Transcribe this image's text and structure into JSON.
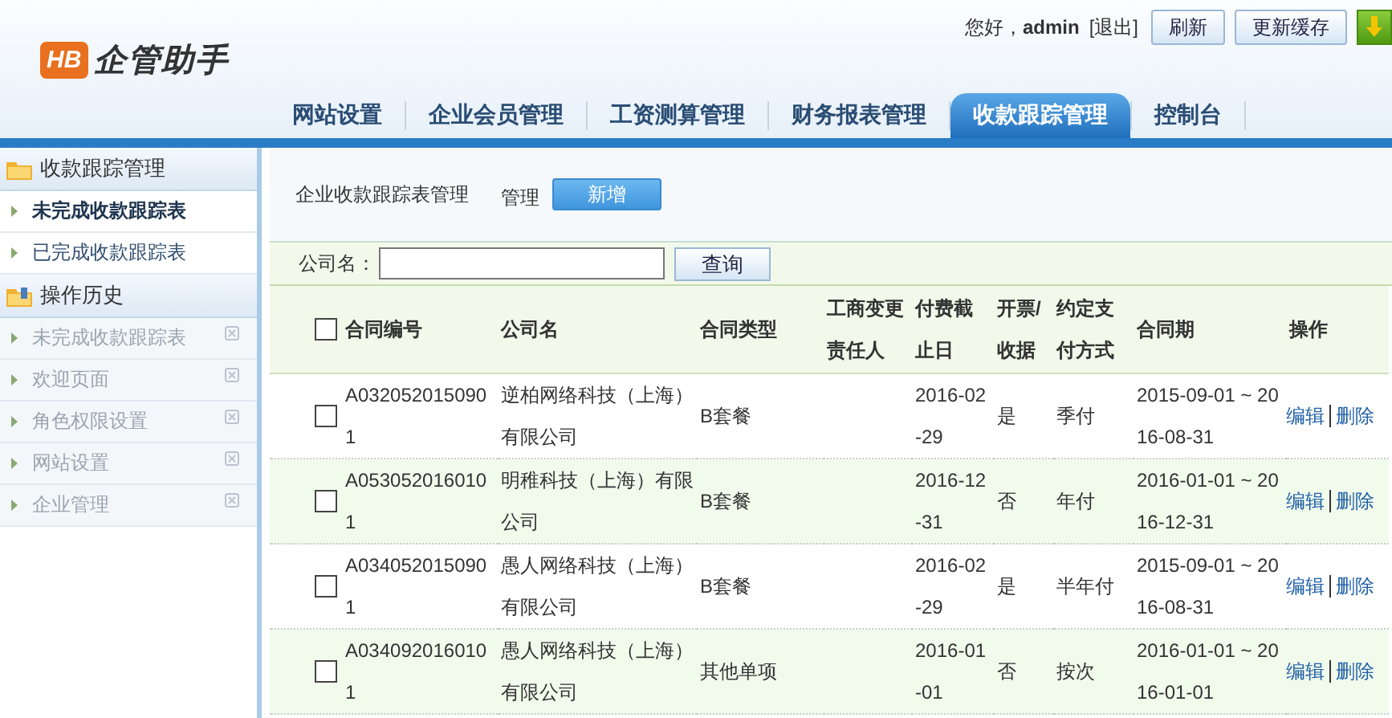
{
  "logo": {
    "badge": "HB",
    "name": "企管助手"
  },
  "top_bar": {
    "greeting": "您好，**admin**",
    "logout": "[退出]",
    "buttons": [
      "刷新",
      "更新缓存"
    ]
  },
  "nav_tabs": [
    {
      "label": "网站设置",
      "selected": false
    },
    {
      "label": "企业会员管理",
      "selected": false
    },
    {
      "label": "工资测算管理",
      "selected": false
    },
    {
      "label": "财务报表管理",
      "selected": false
    },
    {
      "label": "收款跟踪管理",
      "selected": true
    },
    {
      "label": "控制台",
      "selected": false
    }
  ],
  "sidebar": {
    "groups": [
      {
        "title": "收款跟踪管理",
        "kind": "menu",
        "items": [
          {
            "label": "未完成收款跟踪表",
            "selected": true
          },
          {
            "label": "已完成收款跟踪表",
            "selected": false
          }
        ]
      },
      {
        "title": "操作历史",
        "kind": "history",
        "items": [
          {
            "label": "未完成收款跟踪表",
            "selected": false
          },
          {
            "label": "欢迎页面",
            "selected": false
          },
          {
            "label": "角色权限设置",
            "selected": false
          },
          {
            "label": "网站设置",
            "selected": false
          },
          {
            "label": "企业管理",
            "selected": false
          }
        ]
      }
    ]
  },
  "toolbar": {
    "title": "企业收款跟踪表管理",
    "label": "管理",
    "add_button": "新增"
  },
  "search": {
    "label": "公司名：",
    "button": "查询"
  },
  "table": {
    "header_checked": false,
    "columns": [
      "合同编号",
      "公司名",
      "合同类型",
      "工商变更责任人",
      "付费截止日",
      "开票/收据",
      "约定支付方式",
      "合同期",
      "操作"
    ],
    "rows": [
      {
        "checked": false,
        "cells": [
          "A0320520150901",
          "逆柏网络科技（上海）有限公司",
          "B套餐",
          "",
          "2016-02-29",
          "是",
          "季付",
          "2015-09-01 ~ 2016-08-31"
        ],
        "actions": [
          "编辑",
          "删除"
        ]
      },
      {
        "checked": false,
        "cells": [
          "A0530520160101",
          "明稚科技（上海）有限公司",
          "B套餐",
          "",
          "2016-12-31",
          "否",
          "年付",
          "2016-01-01 ~ 2016-12-31"
        ],
        "actions": [
          "编辑",
          "删除"
        ]
      },
      {
        "checked": false,
        "cells": [
          "A0340520150901",
          "愚人网络科技（上海）有限公司",
          "B套餐",
          "",
          "2016-02-29",
          "是",
          "半年付",
          "2015-09-01 ~ 2016-08-31"
        ],
        "actions": [
          "编辑",
          "删除"
        ]
      },
      {
        "checked": false,
        "cells": [
          "A0340920160101",
          "愚人网络科技（上海）有限公司",
          "其他单项",
          "",
          "2016-01-01",
          "否",
          "按次",
          "2016-01-01 ~ 2016-01-01"
        ],
        "actions": [
          "编辑",
          "删除"
        ]
      }
    ]
  }
}
